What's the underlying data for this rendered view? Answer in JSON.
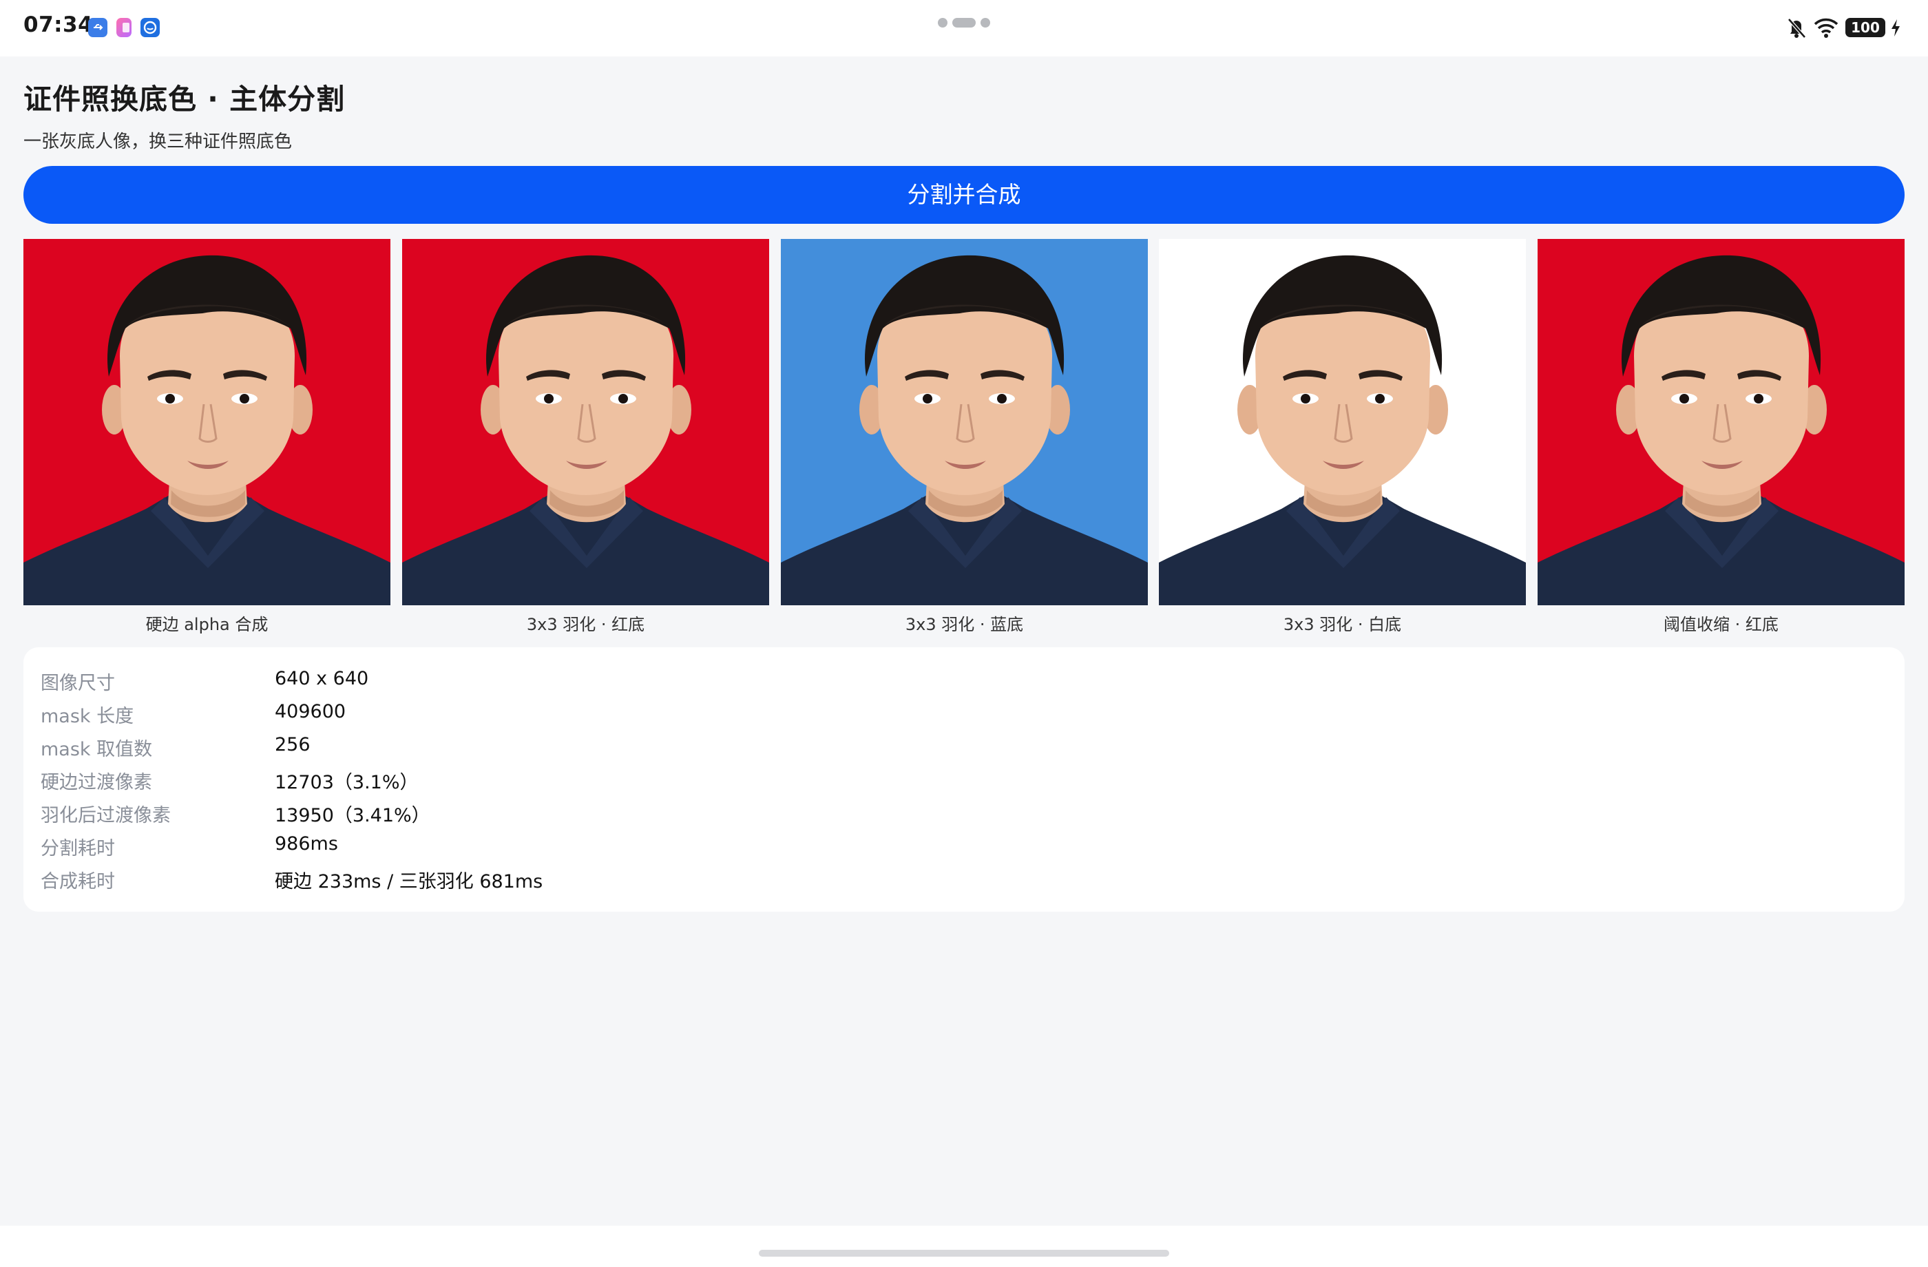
{
  "status_bar": {
    "time": "07:34",
    "app_icons": [
      "usb-icon",
      "app-notification-icon",
      "assistant-icon"
    ],
    "right_icons": [
      "bell-muted-icon",
      "wifi-icon",
      "charging-icon"
    ],
    "battery": "100"
  },
  "page": {
    "title": "证件照换底色 · 主体分割",
    "subtitle": "一张灰底人像，换三种证件照底色",
    "action_button": "分割并合成"
  },
  "colors": {
    "accent": "#0a59f7",
    "red_bg": "#dc0420",
    "blue_bg": "#438edb",
    "white_bg": "#ffffff",
    "shirt": "#1d2a44"
  },
  "results": [
    {
      "caption": "硬边 alpha 合成",
      "background": "red"
    },
    {
      "caption": "3x3 羽化 · 红底",
      "background": "red"
    },
    {
      "caption": "3x3 羽化 · 蓝底",
      "background": "blue"
    },
    {
      "caption": "3x3 羽化 · 白底",
      "background": "white"
    },
    {
      "caption": "阈值收缩 · 红底",
      "background": "red"
    }
  ],
  "stats": [
    {
      "label": "图像尺寸",
      "value": "640 x 640"
    },
    {
      "label": "mask 长度",
      "value": "409600"
    },
    {
      "label": "mask 取值数",
      "value": "256"
    },
    {
      "label": "硬边过渡像素",
      "value": "12703（3.1%）"
    },
    {
      "label": "羽化后过渡像素",
      "value": "13950（3.41%）"
    },
    {
      "label": "分割耗时",
      "value": "986ms"
    },
    {
      "label": "合成耗时",
      "value": "硬边 233ms / 三张羽化 681ms"
    }
  ]
}
